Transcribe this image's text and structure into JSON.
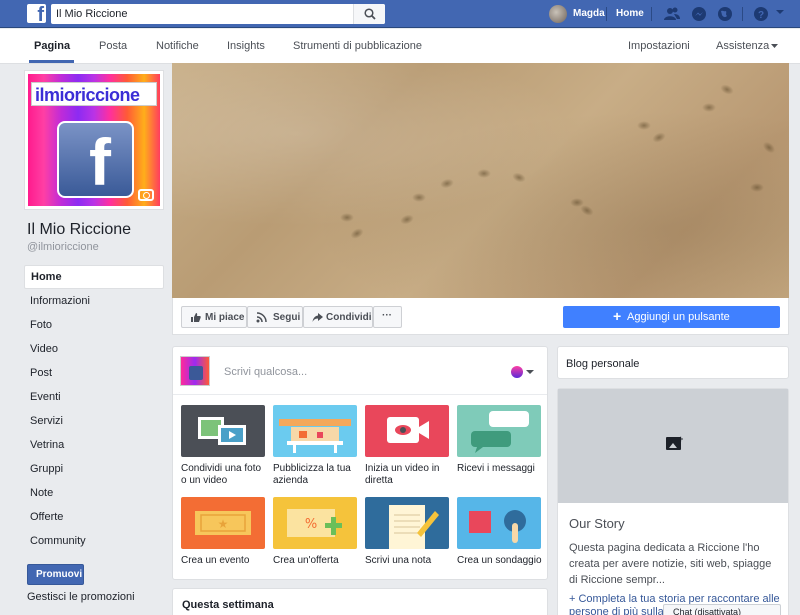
{
  "topbar": {
    "search_value": "Il Mio Riccione",
    "user_name": "Magda",
    "home_label": "Home"
  },
  "subnav": {
    "tabs": [
      {
        "label": "Pagina",
        "active": true
      },
      {
        "label": "Posta"
      },
      {
        "label": "Notifiche"
      },
      {
        "label": "Insights"
      },
      {
        "label": "Strumenti di pubblicazione"
      }
    ],
    "settings_label": "Impostazioni",
    "help_label": "Assistenza"
  },
  "profile": {
    "image_text": "ilmioriccione",
    "page_name": "Il Mio Riccione",
    "handle": "@ilmioriccione"
  },
  "left_nav": {
    "items": [
      "Home",
      "Informazioni",
      "Foto",
      "Video",
      "Post",
      "Eventi",
      "Servizi",
      "Vetrina",
      "Gruppi",
      "Note",
      "Offerte",
      "Community"
    ],
    "promote_label": "Promuovi",
    "manage_promos_label": "Gestisci le promozioni"
  },
  "actions": {
    "like_label": "Mi piace",
    "follow_label": "Segui",
    "share_label": "Condividi",
    "more_label": "···",
    "add_button_label": "Aggiungi un pulsante"
  },
  "composer": {
    "placeholder": "Scrivi qualcosa...",
    "options": [
      {
        "label": "Condividi una foto o un video",
        "icon": "photo-video-icon",
        "bg": "#4b4f56"
      },
      {
        "label": "Pubblicizza la tua azienda",
        "icon": "storefront-icon",
        "bg": "#6bcbef"
      },
      {
        "label": "Inizia un video in diretta",
        "icon": "live-video-icon",
        "bg": "#e9475b"
      },
      {
        "label": "Ricevi i messaggi",
        "icon": "messages-icon",
        "bg": "#7fcbb9"
      },
      {
        "label": "Crea un evento",
        "icon": "ticket-icon",
        "bg": "#f36d34"
      },
      {
        "label": "Crea un'offerta",
        "icon": "offer-icon",
        "bg": "#f5c33b"
      },
      {
        "label": "Scrivi una nota",
        "icon": "note-icon",
        "bg": "#2f6c9c"
      },
      {
        "label": "Crea un sondaggio",
        "icon": "poll-icon",
        "bg": "#56b6e8"
      }
    ]
  },
  "this_week": {
    "title": "Questa settimana"
  },
  "sidebar": {
    "blog_label": "Blog personale",
    "story_title": "Our Story",
    "story_text": "Questa pagina dedicata a Riccione l'ho creata per avere notizie, siti web, spiagge di Riccione sempr...",
    "story_link": "+ Completa la tua storia per raccontare alle persone di più sulla",
    "chat_label": "Chat (disattivata)"
  },
  "colors": {
    "brand": "#4267b2",
    "accent_button": "#4080ff"
  }
}
